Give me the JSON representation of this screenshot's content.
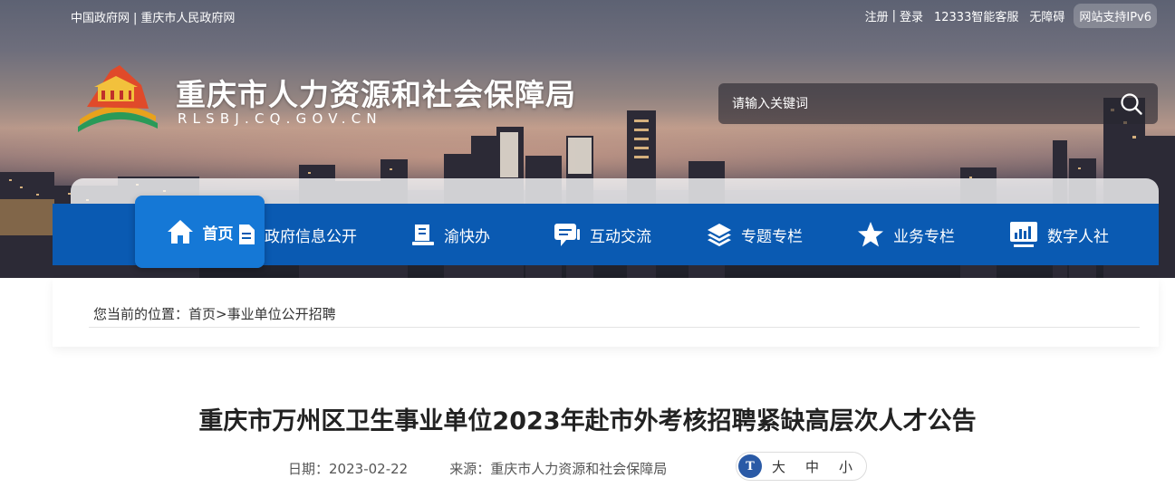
{
  "top_links": {
    "left": [
      "中国政府网",
      "重庆市人民政府网"
    ],
    "left_sep": "|",
    "right": [
      "注册",
      "登录",
      "12333智能客服",
      "无障碍"
    ],
    "ipv6": "网站支持IPv6"
  },
  "site": {
    "title": "重庆市人力资源和社会保障局",
    "domain": "RLSBJ.CQ.GOV.CN"
  },
  "search": {
    "placeholder": "请输入关键词"
  },
  "nav": {
    "items": [
      {
        "label": "首页",
        "icon": "home-icon",
        "active": true
      },
      {
        "label": "政府信息公开",
        "icon": "document-icon"
      },
      {
        "label": "渝快办",
        "icon": "book-icon"
      },
      {
        "label": "互动交流",
        "icon": "chat-icon"
      },
      {
        "label": "专题专栏",
        "icon": "layers-icon"
      },
      {
        "label": "业务专栏",
        "icon": "star-icon"
      },
      {
        "label": "数字人社",
        "icon": "chart-monitor-icon"
      }
    ]
  },
  "breadcrumb": {
    "prefix": "您当前的位置：",
    "home": "首页",
    "sep": ">",
    "current": "事业单位公开招聘"
  },
  "article": {
    "title": "重庆市万州区卫生事业单位2023年赴市外考核招聘紧缺高层次人才公告",
    "date_label": "日期：",
    "date": "2023-02-22",
    "source_label": "来源：",
    "source": "重庆市人力资源和社会保障局",
    "font_icon": "T",
    "font_sizes": [
      "大",
      "中",
      "小"
    ]
  },
  "colors": {
    "nav_bg": "#0a5ab2",
    "nav_active": "#1578d6",
    "font_icon_bg": "#2a5aa6"
  }
}
